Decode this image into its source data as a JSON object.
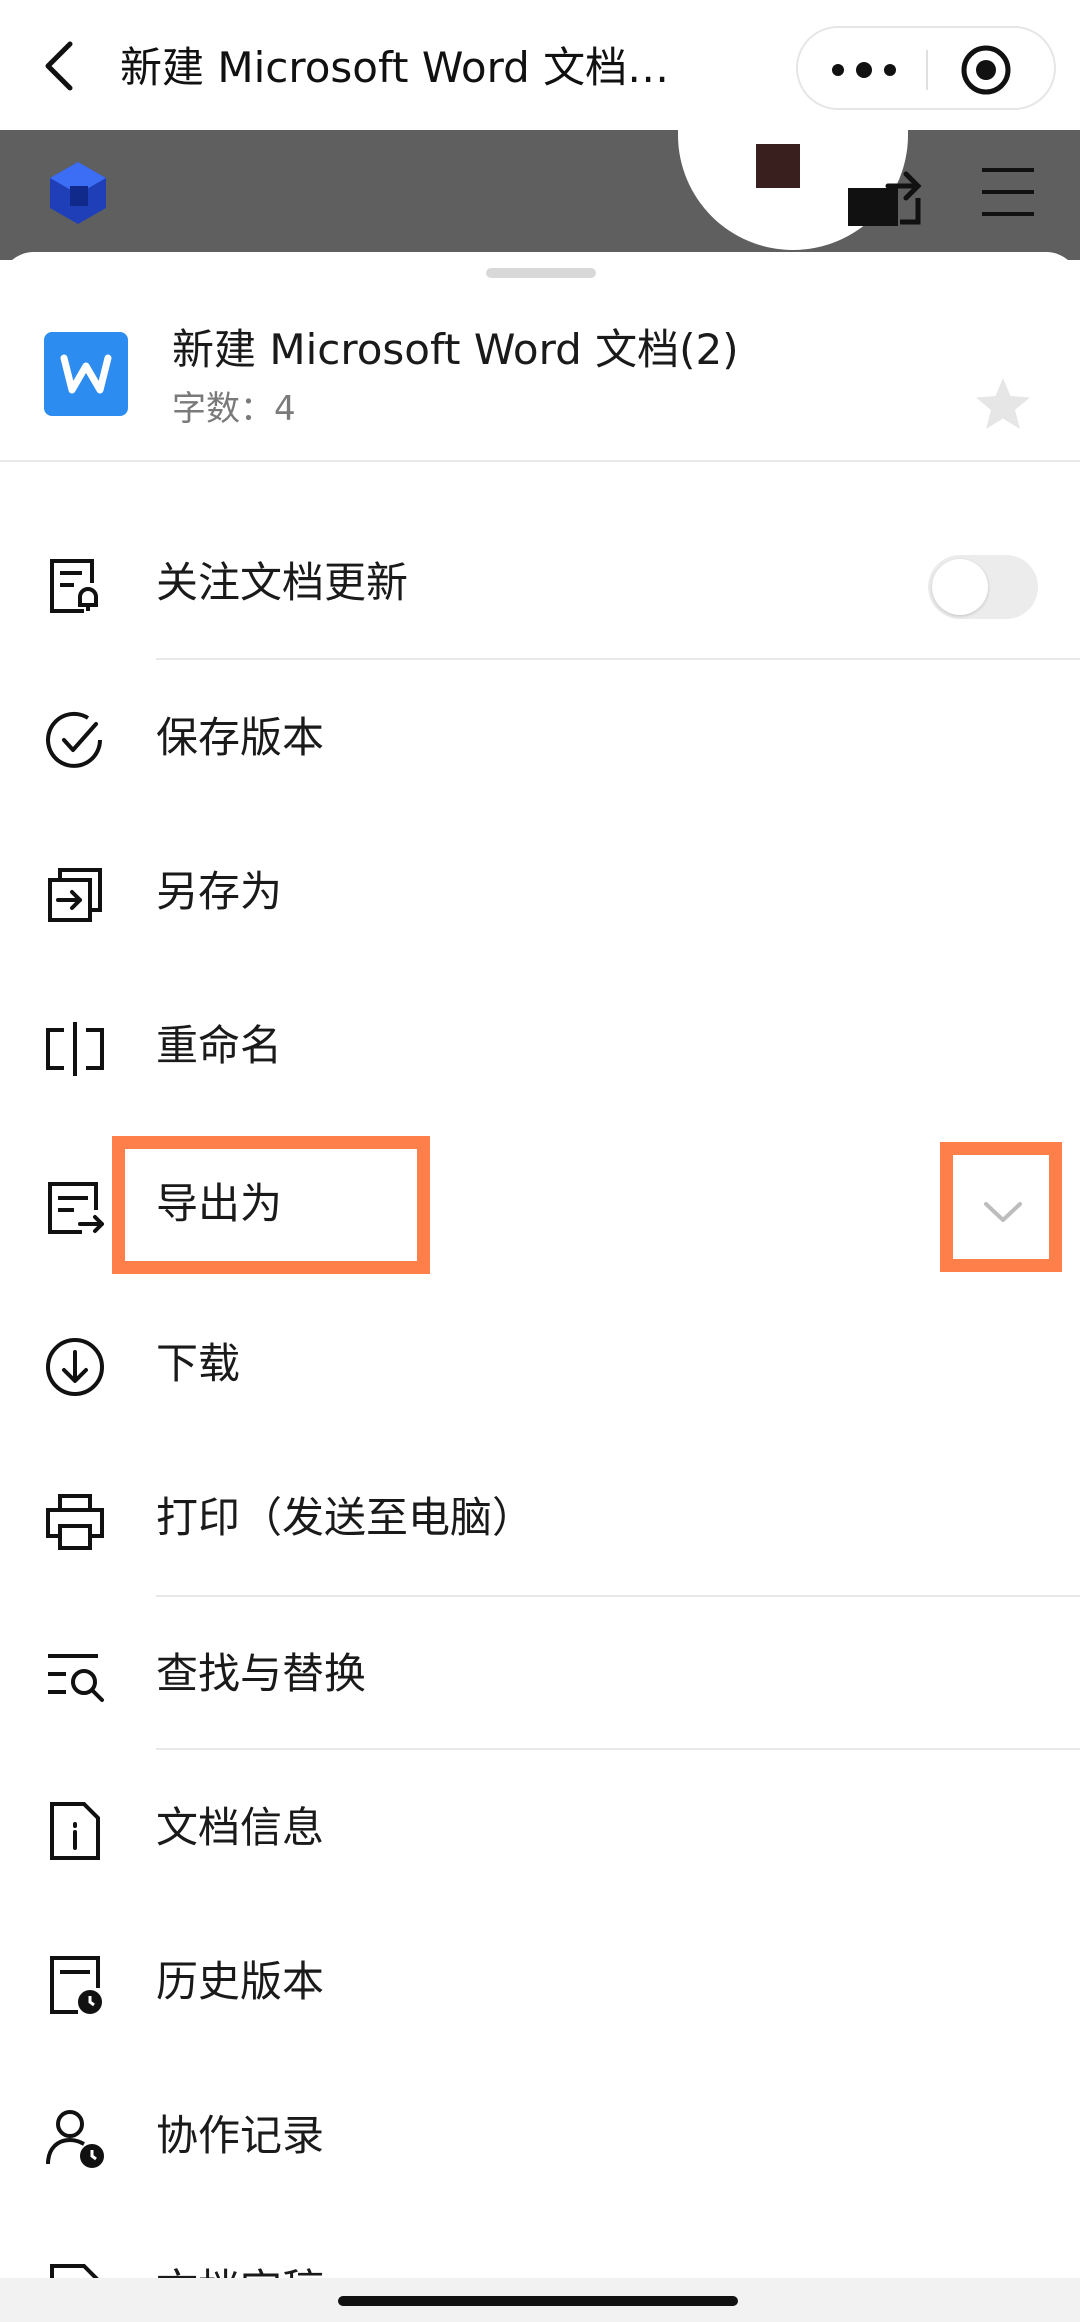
{
  "nav": {
    "title": "新建 Microsoft Word 文档…",
    "back_icon": "chevron-left-icon",
    "more_icon": "more-dots-icon",
    "close_icon": "target-circle-icon"
  },
  "doc_toolbar": {
    "logo_icon": "app-cube-logo-icon",
    "share_icon": "share-export-icon",
    "menu_icon": "hamburger-menu-icon"
  },
  "file": {
    "name": "新建 Microsoft Word 文档(2)",
    "meta_label": "字数：",
    "word_count": "4",
    "icon_letter": "W",
    "icon_color": "#2d8cf0",
    "star_icon": "star-icon"
  },
  "menu": {
    "items": [
      {
        "label": "关注文档更新",
        "icon": "doc-bell-icon",
        "toggle_on": false
      },
      {
        "label": "保存版本",
        "icon": "check-circle-icon"
      },
      {
        "label": "另存为",
        "icon": "save-as-icon"
      },
      {
        "label": "重命名",
        "icon": "rename-cursor-icon"
      },
      {
        "label": "导出为",
        "icon": "export-doc-icon",
        "expand_icon": "chevron-down-icon"
      },
      {
        "label": "下载",
        "icon": "download-circle-icon"
      },
      {
        "label": "打印（发送至电脑）",
        "icon": "printer-icon"
      },
      {
        "label": "查找与替换",
        "icon": "find-replace-icon"
      },
      {
        "label": "文档信息",
        "icon": "doc-info-icon"
      },
      {
        "label": "历史版本",
        "icon": "history-version-icon"
      },
      {
        "label": "协作记录",
        "icon": "collab-record-icon"
      },
      {
        "label": "文档定稿",
        "icon": "doc-finalize-icon"
      }
    ]
  },
  "colors": {
    "highlight": "#ff7f4a",
    "toolbar_bg": "#5f5f5f",
    "divider": "#e8e8e8"
  }
}
